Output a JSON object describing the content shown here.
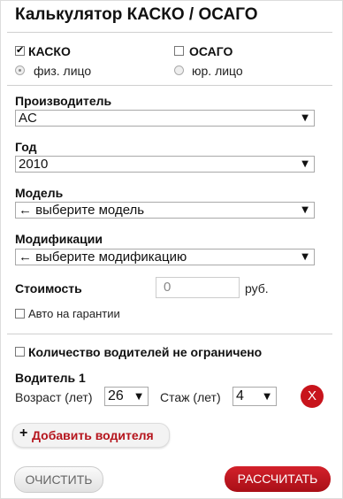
{
  "title": "Калькулятор КАСКО / ОСАГО",
  "insurance": {
    "kasko": {
      "label": "КАСКО",
      "checked": true
    },
    "osago": {
      "label": "ОСАГО",
      "checked": false
    }
  },
  "person": {
    "individual": {
      "label": "физ. лицо",
      "selected": true
    },
    "legal": {
      "label": "юр. лицо",
      "selected": false
    }
  },
  "form": {
    "manufacturer": {
      "label": "Производитель",
      "value": "AC"
    },
    "year": {
      "label": "Год",
      "value": "2010"
    },
    "model": {
      "label": "Модель",
      "value": "← выберите модель"
    },
    "modification": {
      "label": "Модификации",
      "value": "← выберите модификацию"
    },
    "cost": {
      "label": "Стоимость",
      "value": "0",
      "unit": "руб."
    },
    "warranty": {
      "label": "Авто на гарантии",
      "checked": false
    }
  },
  "drivers": {
    "unlimited": {
      "label": "Количество водителей не ограничено",
      "checked": false
    },
    "list": [
      {
        "title": "Водитель 1",
        "age_label": "Возраст (лет)",
        "age_value": "26",
        "exp_label": "Стаж (лет)",
        "exp_value": "4",
        "remove_label": "X"
      }
    ],
    "add_label": "Добавить водителя",
    "add_icon": "+"
  },
  "actions": {
    "clear": "ОЧИСТИТЬ",
    "calculate": "РАССЧИТАТЬ"
  },
  "icons": {
    "select_arrow": "▼"
  },
  "colors": {
    "accent": "#c8141c",
    "text": "#111111"
  }
}
